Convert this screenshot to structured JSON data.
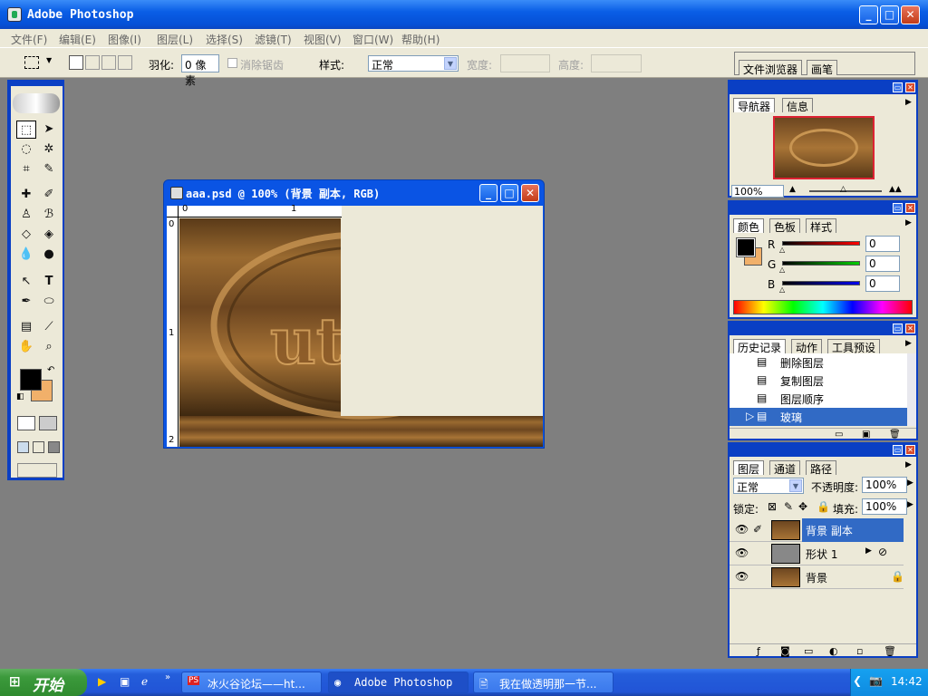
{
  "app": {
    "title": "Adobe Photoshop"
  },
  "menu": [
    "文件(F)",
    "编辑(E)",
    "图像(I)",
    "图层(L)",
    "选择(S)",
    "滤镜(T)",
    "视图(V)",
    "窗口(W)",
    "帮助(H)"
  ],
  "options": {
    "feather_label": "羽化:",
    "feather_value": "0 像素",
    "antialias_label": "消除锯齿",
    "style_label": "样式:",
    "style_value": "正常",
    "width_label": "宽度:",
    "height_label": "高度:",
    "tab_browser": "文件浏览器",
    "tab_brush": "画笔"
  },
  "document": {
    "title": "aaa.psd @ 100% (背景 副本, RGB)",
    "ruler_h": [
      "0",
      "1"
    ],
    "ruler_v": [
      "0",
      "1",
      "2"
    ]
  },
  "navigator": {
    "tabs": [
      "导航器",
      "信息"
    ],
    "zoom": "100%"
  },
  "color": {
    "tabs": [
      "颜色",
      "色板",
      "样式"
    ],
    "r_label": "R",
    "g_label": "G",
    "b_label": "B",
    "r": "0",
    "g": "0",
    "b": "0",
    "fg": "#000000",
    "bg": "#f1b06a"
  },
  "history": {
    "tabs": [
      "历史记录",
      "动作",
      "工具预设"
    ],
    "items": [
      "删除图层",
      "复制图层",
      "图层顺序",
      "玻璃"
    ]
  },
  "layers": {
    "tabs": [
      "图层",
      "通道",
      "路径"
    ],
    "blend": "正常",
    "opacity_label": "不透明度:",
    "opacity": "100%",
    "lock_label": "锁定:",
    "fill_label": "填充:",
    "fill": "100%",
    "items": [
      "背景 副本",
      "形状 1",
      "背景"
    ]
  },
  "taskbar": {
    "start": "开始",
    "windows": [
      "冰火谷论坛——ht...",
      "Adobe Photoshop",
      "我在做透明那一节..."
    ],
    "time": "14:42"
  }
}
